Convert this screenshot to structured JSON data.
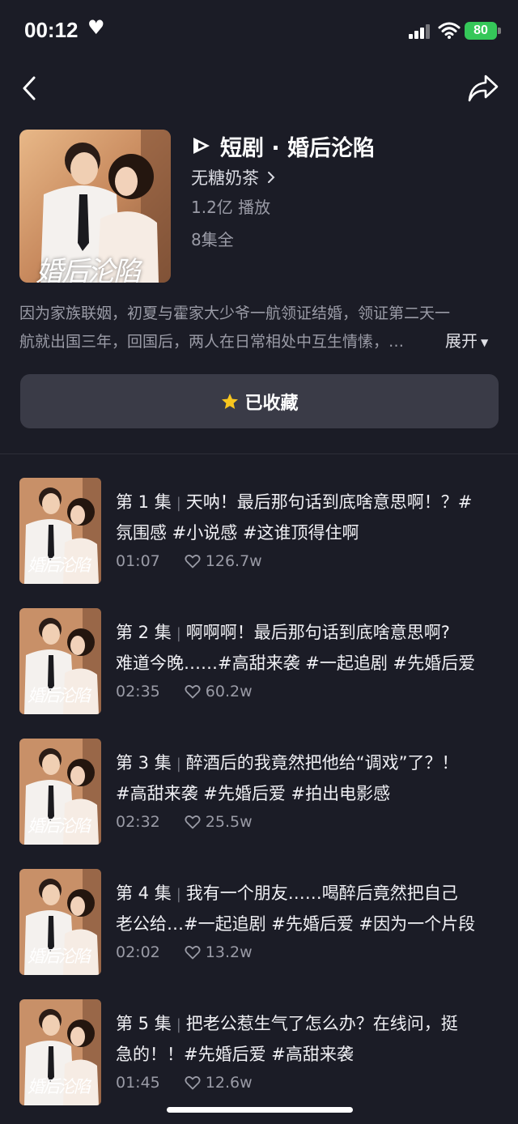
{
  "status": {
    "time": "00:12",
    "battery": "80"
  },
  "drama": {
    "title": "短剧 · 婚后沦陷",
    "cover_text": "婚后沦陷",
    "author": "无糖奶茶",
    "plays": "1.2亿 播放",
    "episodes_total": "8集全",
    "description_line1": "因为家族联姻，初夏与霍家大少爷一航领证结婚，领证第二天一",
    "description_line2": "航就出国三年，回国后，两人在日常相处中互生情愫，…",
    "expand_label": "展开"
  },
  "collect_button": {
    "label": "已收藏"
  },
  "episodes": [
    {
      "label": "第 1 集",
      "line1": "天呐！最后那句话到底啥意思啊！？#",
      "line2": "氛围感 #小说感 #这谁顶得住啊",
      "duration": "01:07",
      "likes": "126.7w"
    },
    {
      "label": "第 2 集",
      "line1": "啊啊啊！最后那句话到底啥意思啊?",
      "line2": "难道今晚……#高甜来袭 #一起追剧 #先婚后爱",
      "duration": "02:35",
      "likes": "60.2w"
    },
    {
      "label": "第 3 集",
      "line1": "醉酒后的我竟然把他给“调戏”了？！",
      "line2": "#高甜来袭 #先婚后爱 #拍出电影感",
      "duration": "02:32",
      "likes": "25.5w"
    },
    {
      "label": "第 4 集",
      "line1": "我有一个朋友……喝醉后竟然把自己",
      "line2": "老公给…#一起追剧 #先婚后爱 #因为一个片段",
      "duration": "02:02",
      "likes": "13.2w"
    },
    {
      "label": "第 5 集",
      "line1": "把老公惹生气了怎么办？在线问，挺",
      "line2": "急的！！#先婚后爱 #高甜来袭",
      "duration": "01:45",
      "likes": "12.6w"
    }
  ],
  "colors": {
    "background": "#1b1c26",
    "button_bg": "#3a3b47",
    "battery": "#35c759",
    "star": "#f7c51e"
  }
}
